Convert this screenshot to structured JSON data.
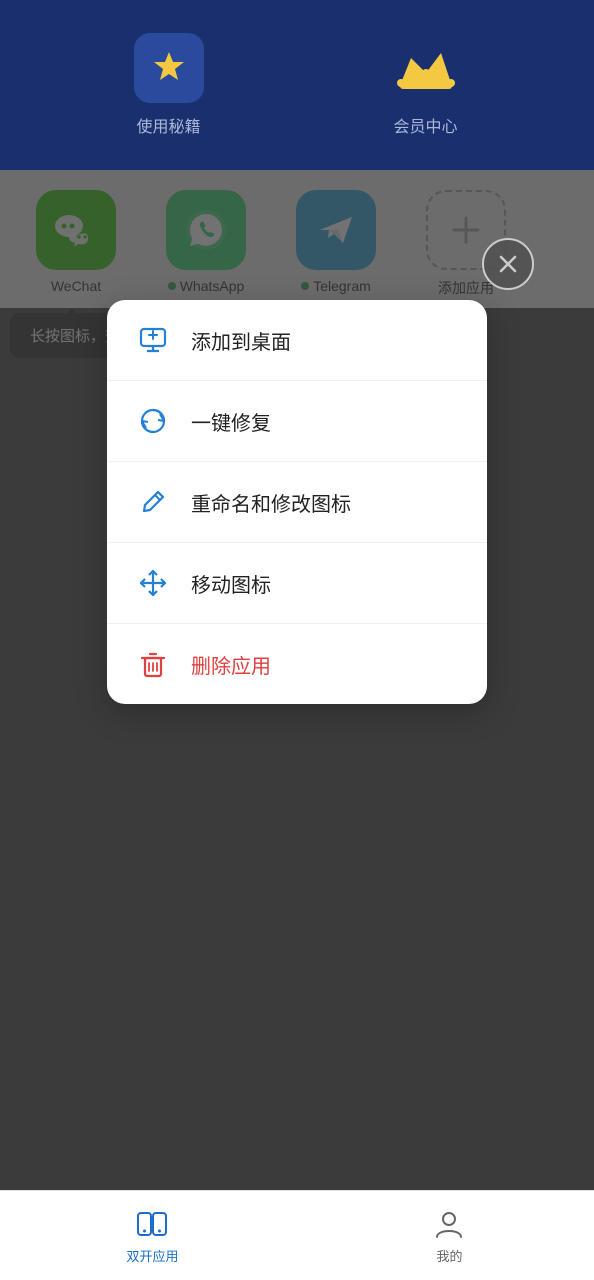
{
  "header": {
    "items": [
      {
        "id": "secrets",
        "icon": "⭐",
        "label": "使用秘籍"
      },
      {
        "id": "vip",
        "icon": "👑",
        "label": "会员中心"
      }
    ]
  },
  "app_grid": {
    "apps": [
      {
        "id": "wechat",
        "name": "WeChat",
        "icon": "wechat",
        "has_dot": false
      },
      {
        "id": "whatsapp",
        "name": "WhatsApp",
        "icon": "whatsapp",
        "has_dot": true
      },
      {
        "id": "telegram",
        "name": "Telegram",
        "icon": "telegram",
        "has_dot": true
      },
      {
        "id": "add",
        "name": "添加应用",
        "icon": "add",
        "has_dot": false
      }
    ],
    "tooltip": "长按图标，查看更多功能"
  },
  "context_menu": {
    "items": [
      {
        "id": "add-desktop",
        "label": "添加到桌面",
        "icon": "desktop",
        "color": "normal"
      },
      {
        "id": "one-key-repair",
        "label": "一键修复",
        "icon": "repair",
        "color": "normal"
      },
      {
        "id": "rename",
        "label": "重命名和修改图标",
        "icon": "edit",
        "color": "normal"
      },
      {
        "id": "move",
        "label": "移动图标",
        "icon": "move",
        "color": "normal"
      },
      {
        "id": "delete",
        "label": "删除应用",
        "icon": "trash",
        "color": "red"
      }
    ]
  },
  "bottom_nav": {
    "items": [
      {
        "id": "dual-app",
        "label": "双开应用",
        "icon": "dual"
      },
      {
        "id": "mine",
        "label": "我的",
        "icon": "person"
      }
    ]
  }
}
